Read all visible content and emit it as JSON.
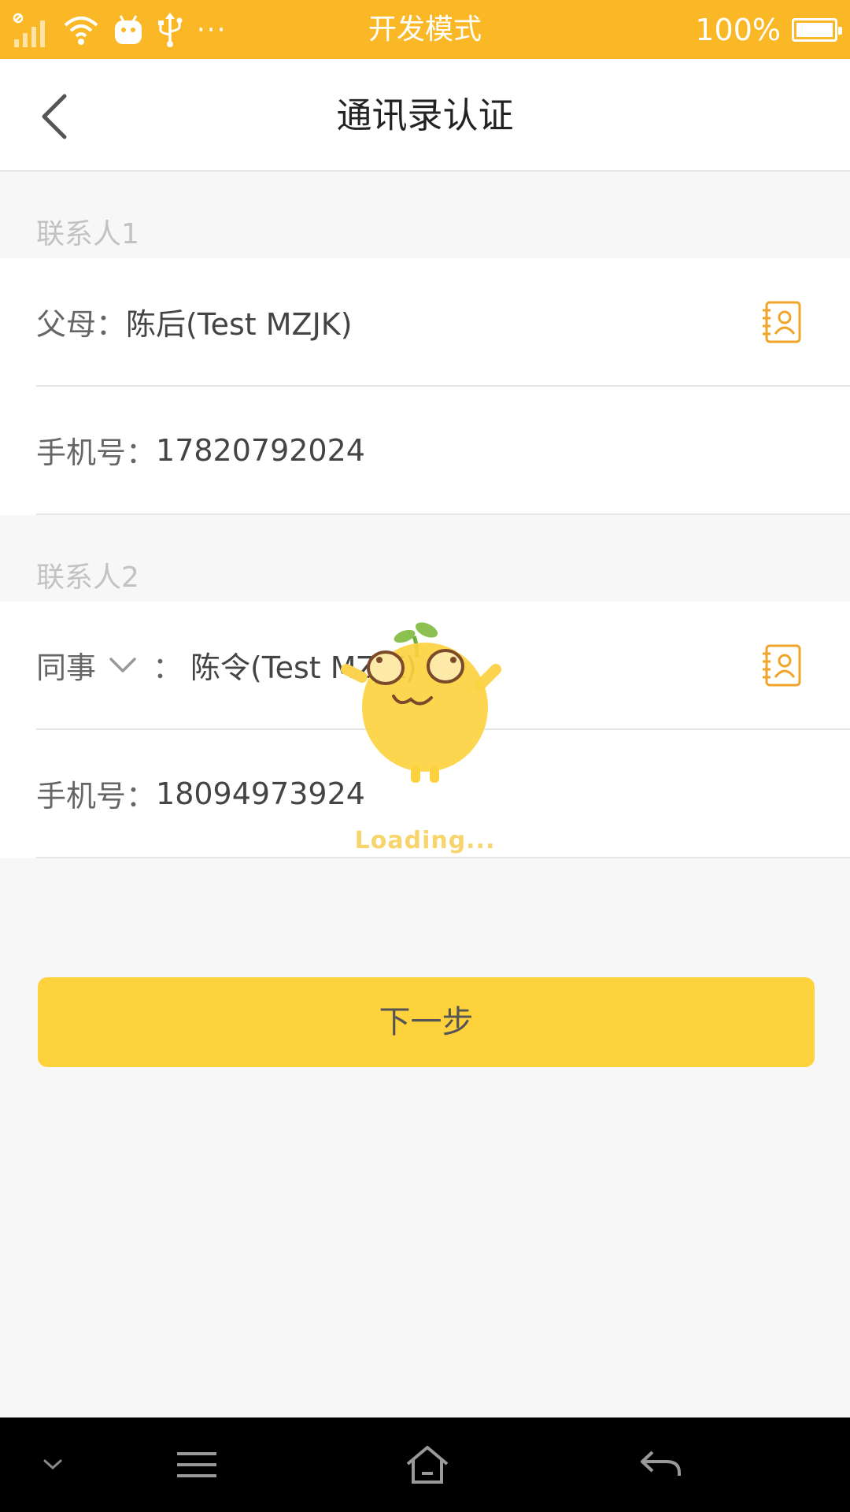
{
  "status_bar": {
    "center_text": "开发模式",
    "battery_text": "100%",
    "battery_level": 1.0,
    "more_glyph": "···",
    "icons": [
      "signal-icon",
      "wifi-icon",
      "android-icon",
      "usb-icon",
      "more-icon",
      "battery-icon"
    ]
  },
  "header": {
    "title": "通讯录认证",
    "back_icon": "chevron-left-icon"
  },
  "contact1": {
    "section_label": "联系人1",
    "relation_label": "父母：",
    "name": "陈后(Test MZJK)",
    "phone_label": "手机号：",
    "phone": "17820792024",
    "picker_icon": "contact-book-icon"
  },
  "contact2": {
    "section_label": "联系人2",
    "relation_label": "同事",
    "relation_suffix": "：",
    "name": "陈令(Test MZJK)",
    "phone_label": "手机号：",
    "phone": "18094973924",
    "dropdown_icon": "chevron-down-icon",
    "picker_icon": "contact-book-icon"
  },
  "actions": {
    "next_label": "下一步"
  },
  "loading": {
    "text": "Loading...",
    "mascot_icon": "sprout-mascot-icon"
  },
  "nav_bar": {
    "icons": [
      "collapse-icon",
      "menu-icon",
      "home-icon",
      "return-icon"
    ]
  },
  "colors": {
    "status_bar": "#fbb826",
    "accent": "#f0a52a",
    "button": "#fed23c",
    "loading_text": "#f7d56c"
  }
}
